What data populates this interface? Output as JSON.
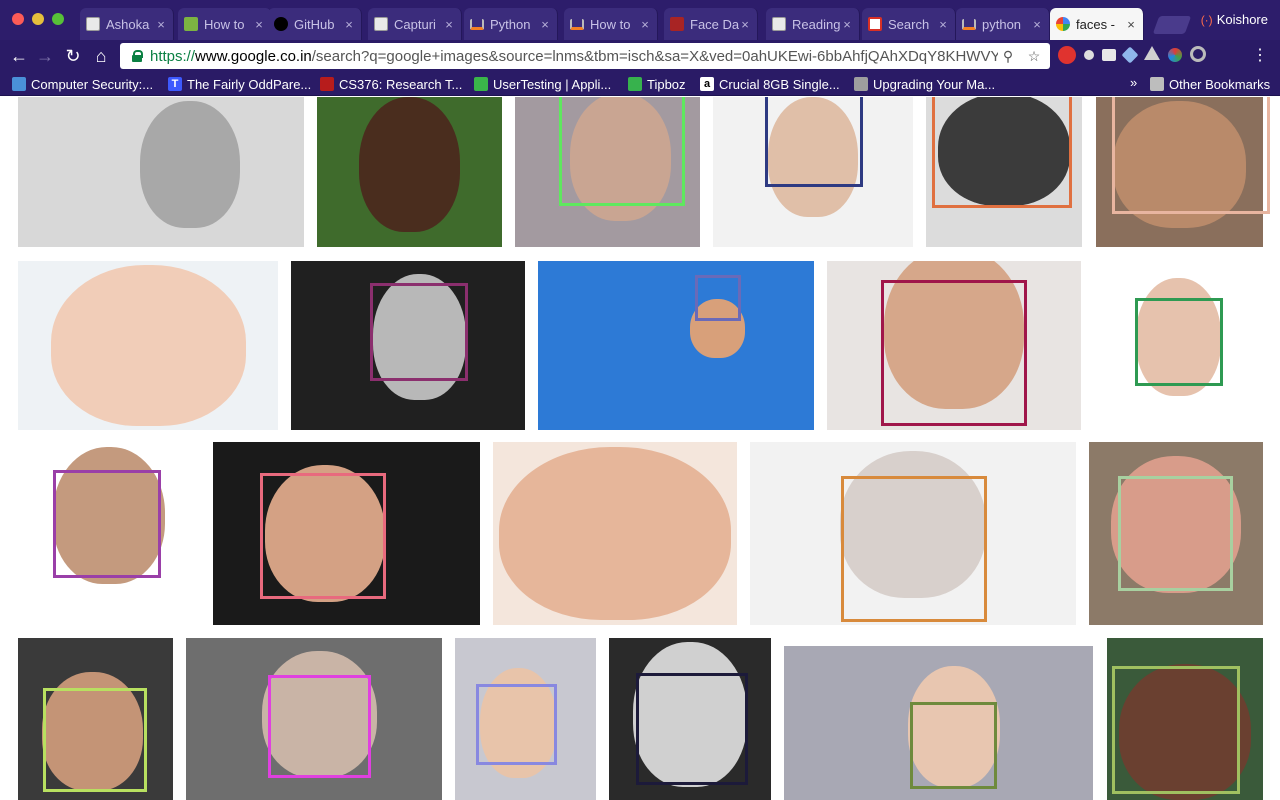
{
  "window": {
    "profile_name": "Koishore"
  },
  "tabs": [
    {
      "title": "Ashoka",
      "icon": "document-icon",
      "active": false
    },
    {
      "title": "How to",
      "icon": "wikihow-icon",
      "active": false
    },
    {
      "title": "GitHub",
      "icon": "github-icon",
      "active": false
    },
    {
      "title": "Capturi",
      "icon": "document-icon",
      "active": false
    },
    {
      "title": "Python",
      "icon": "stackoverflow-icon",
      "active": false
    },
    {
      "title": "How to",
      "icon": "stackoverflow-icon",
      "active": false
    },
    {
      "title": "Face Da",
      "icon": "facedata-icon",
      "active": false
    },
    {
      "title": "Reading",
      "icon": "document-icon",
      "active": false
    },
    {
      "title": "Search",
      "icon": "gmail-icon",
      "active": false
    },
    {
      "title": "python",
      "icon": "stackoverflow-icon",
      "active": false
    },
    {
      "title": "faces -",
      "icon": "google-icon",
      "active": true
    }
  ],
  "toolbar": {
    "url_scheme": "https://",
    "url_host": "www.google.co.in",
    "url_rest": "/search?q=google+images&source=lnms&tbm=isch&sa=X&ved=0ahUKEwi-6bbAhfjQAhXDqY8KHWVYA..."
  },
  "bookmarks": [
    {
      "label": "Computer Security:...",
      "icon": "bookmark-icon"
    },
    {
      "label": "The Fairly OddPare...",
      "icon": "t-icon"
    },
    {
      "label": "CS376: Research T...",
      "icon": "cs376-icon"
    },
    {
      "label": "UserTesting | Appli...",
      "icon": "usertesting-icon"
    },
    {
      "label": "Tipboz",
      "icon": "tipboz-icon"
    },
    {
      "label": "Crucial 8GB Single...",
      "icon": "amazon-icon"
    },
    {
      "label": "Upgrading Your Ma...",
      "icon": "apple-icon"
    }
  ],
  "bookmarks_more": "»",
  "other_bookmarks": "Other Bookmarks",
  "colors": {
    "chrome_bg": "#2a1b66",
    "tab_bg": "#3b2c7c",
    "url_green": "#0b8043"
  },
  "images": [
    {
      "bg": "#d8d8d8",
      "skin": "#a8a8a8",
      "box": null
    },
    {
      "bg": "#3f6b2c",
      "skin": "#4a2d1e",
      "box": null
    },
    {
      "bg": "#a39aa0",
      "skin": "#c9a592",
      "box": "#5ee85e"
    },
    {
      "bg": "#f2f2f2",
      "skin": "#e0bfa8",
      "box": "#2e3a82"
    },
    {
      "bg": "#dcdcdc",
      "skin": "#3b3b3b",
      "box": "#e07040"
    },
    {
      "bg": "#8a6f5c",
      "skin": "#b98a6a",
      "box": "#e8b5a0"
    },
    {
      "bg": "#eef2f5",
      "skin": "#f1cdb8",
      "box": null
    },
    {
      "bg": "#202020",
      "skin": "#b8b8b8",
      "box": "#8b2f6e"
    },
    {
      "bg": "#2d7ad6",
      "skin": "#d8a07a",
      "box": "#6a6ab8"
    },
    {
      "bg": "#e8e4e2",
      "skin": "#d6a78a",
      "box": "#a0164a"
    },
    {
      "bg": "#ffffff",
      "skin": "#e6c2ad",
      "box": "#2e9a52"
    },
    {
      "bg": "#ffffff",
      "skin": "#c49a7e",
      "box": "#9a3fa8"
    },
    {
      "bg": "#1a1a1a",
      "skin": "#d4a184",
      "box": "#e86a7e"
    },
    {
      "bg": "#f4e6dc",
      "skin": "#e6b69a",
      "box": null
    },
    {
      "bg": "#f2f2f2",
      "skin": "#d8d0cc",
      "box": "#d88a3c"
    },
    {
      "bg": "#8c7a68",
      "skin": "#d89c8a",
      "box": "#a8d0a0"
    },
    {
      "bg": "#3a3a3a",
      "skin": "#c49476",
      "box": "#b8e060"
    },
    {
      "bg": "#6e6e6e",
      "skin": "#c9b4a6",
      "box": "#e040e0"
    },
    {
      "bg": "#c8c8d0",
      "skin": "#e8c4aa",
      "box": "#8888e0"
    },
    {
      "bg": "#2a2a2a",
      "skin": "#d0d0d0",
      "box": "#1c1a3a"
    },
    {
      "bg": "#a8a8b4",
      "skin": "#e8c6b0",
      "box": "#6e8a3c"
    },
    {
      "bg": "#3a5a3a",
      "skin": "#6a4030",
      "box": "#a0c060"
    }
  ]
}
